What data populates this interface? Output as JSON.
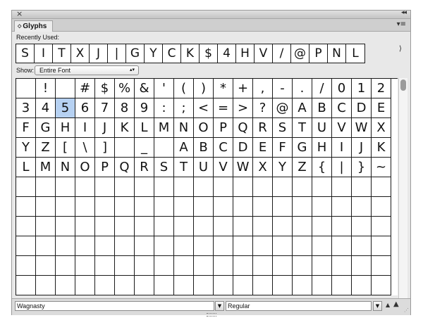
{
  "panel": {
    "tab_label": "Glyphs",
    "recently_used_label": "Recently Used:",
    "show_label": "Show:",
    "show_value": "Entire Font",
    "font_value": "Wagnasty",
    "style_value": "Regular"
  },
  "icons": {
    "close": "close-icon",
    "collapse": "collapse-icon",
    "menu": "panel-menu-icon",
    "zoom_out": "zoom-out-icon",
    "zoom_in": "zoom-in-icon"
  },
  "recent_glyphs": [
    "S",
    "I",
    "T",
    "X",
    "J",
    "|",
    "G",
    "Y",
    "C",
    "K",
    "$",
    "4",
    "H",
    "V",
    "/",
    "@",
    "P",
    "N",
    "L"
  ],
  "glyph_rows": [
    [
      "",
      "!",
      "",
      "#",
      "$",
      "%",
      "&",
      "'",
      "(",
      ")",
      "*",
      "+",
      ",",
      "-",
      ".",
      "/",
      "0",
      "1",
      "2"
    ],
    [
      "3",
      "4",
      "5",
      "6",
      "7",
      "8",
      "9",
      ":",
      ";",
      "<",
      "=",
      ">",
      "?",
      "@",
      "A",
      "B",
      "C",
      "D",
      "E"
    ],
    [
      "F",
      "G",
      "H",
      "I",
      "J",
      "K",
      "L",
      "M",
      "N",
      "O",
      "P",
      "Q",
      "R",
      "S",
      "T",
      "U",
      "V",
      "W",
      "X"
    ],
    [
      "Y",
      "Z",
      "[",
      "\\",
      "]",
      "",
      "_",
      "",
      "A",
      "B",
      "C",
      "D",
      "E",
      "F",
      "G",
      "H",
      "I",
      "J",
      "K"
    ],
    [
      "L",
      "M",
      "N",
      "O",
      "P",
      "Q",
      "R",
      "S",
      "T",
      "U",
      "V",
      "W",
      "X",
      "Y",
      "Z",
      "{",
      "|",
      "}",
      "~"
    ],
    [
      "",
      "",
      "",
      "",
      "",
      "",
      "",
      "",
      "",
      "",
      "",
      "",
      "",
      "",
      "",
      "",
      "",
      "",
      ""
    ],
    [
      "",
      "",
      "",
      "",
      "",
      "",
      "",
      "",
      "",
      "",
      "",
      "",
      "",
      "",
      "",
      "",
      "",
      "",
      ""
    ],
    [
      "",
      "",
      "",
      "",
      "",
      "",
      "",
      "",
      "",
      "",
      "",
      "",
      "",
      "",
      "",
      "",
      "",
      "",
      ""
    ],
    [
      "",
      "",
      "",
      "",
      "",
      "",
      "",
      "",
      "",
      "",
      "",
      "",
      "",
      "",
      "",
      "",
      "",
      "",
      ""
    ],
    [
      "",
      "",
      "",
      "",
      "",
      "",
      "",
      "",
      "",
      "",
      "",
      "",
      "",
      "",
      "",
      "",
      "",
      "",
      ""
    ],
    [
      "",
      "",
      "",
      "",
      "",
      "",
      "",
      "",
      "",
      "",
      "",
      "",
      "",
      "",
      "",
      "",
      "",
      "",
      ""
    ]
  ],
  "selected_glyph": "5",
  "colors": {
    "selection": "#b6d1f2",
    "panel_bg": "#e8e8e8"
  }
}
